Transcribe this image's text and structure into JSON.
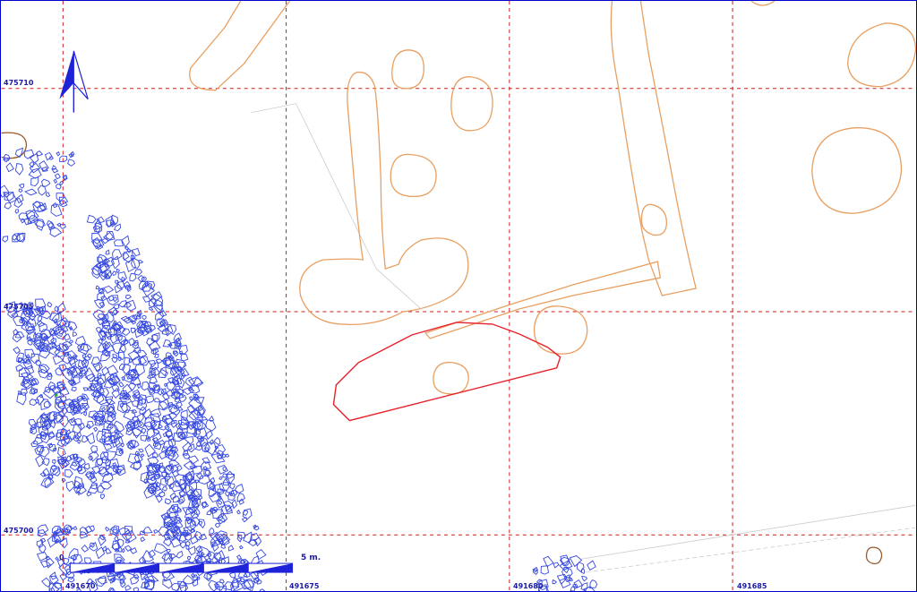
{
  "colors": {
    "grid": "#d01a1a",
    "feature_orange": "#e8a062",
    "feature_red": "#e8202a",
    "stones_blue": "#3548e0",
    "label_blue": "#1a1aa6",
    "north_arrow": "#1e22d8",
    "brown_circle": "#9a5a2a"
  },
  "grid": {
    "northing_labels": [
      "475710",
      "475705",
      "475700"
    ],
    "easting_labels": [
      "491670",
      "491675",
      "491680",
      "491685"
    ]
  },
  "scale_bar": {
    "label": "5 m.",
    "zero_label": "0"
  },
  "north_arrow": {
    "icon": "north-arrow-icon"
  },
  "features": {
    "outlines_orange": "archaeological-feature-outlines",
    "highlighted_red": "highlighted-feature",
    "stones_blue": "stone-scatter"
  }
}
